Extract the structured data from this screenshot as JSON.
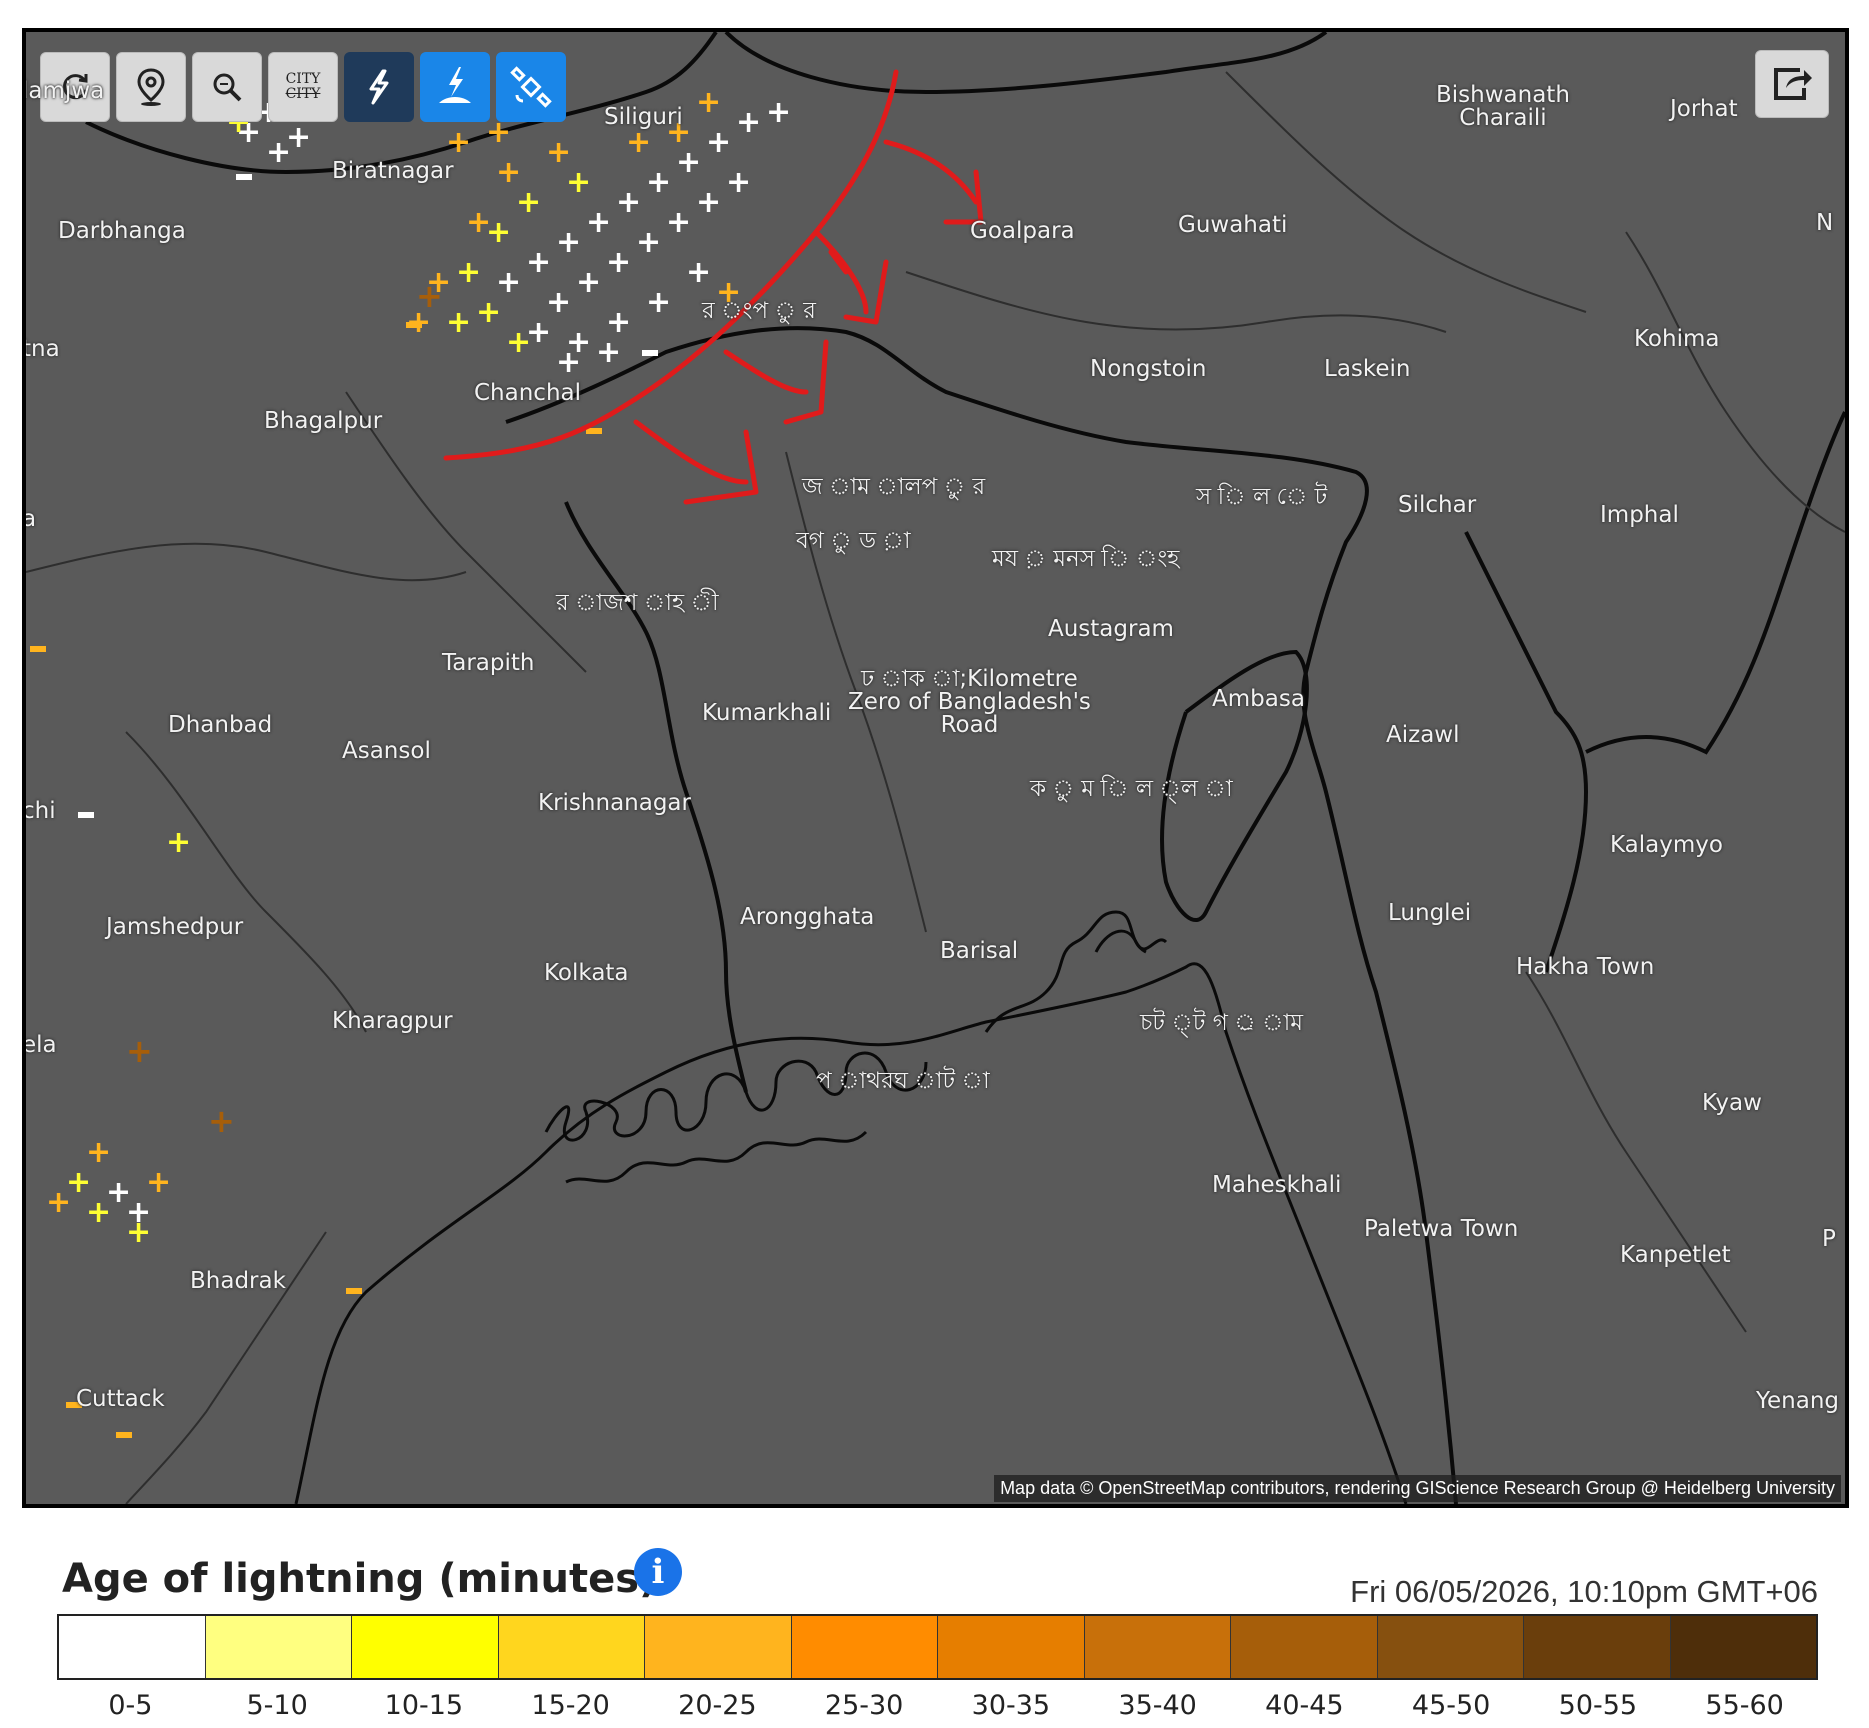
{
  "toolbar": {
    "buttons": [
      {
        "name": "refresh-icon"
      },
      {
        "name": "location-pin-icon"
      },
      {
        "name": "zoom-icon"
      },
      {
        "name": "city-toggle",
        "text_top": "CITY",
        "text_bottom": "CITY"
      },
      {
        "name": "lightning-icon"
      },
      {
        "name": "lightning-ground-icon"
      },
      {
        "name": "satellite-icon"
      }
    ],
    "share": "share-icon"
  },
  "map": {
    "attribution": "Map data © OpenStreetMap contributors, rendering GIScience Research Group @ Heidelberg University",
    "cities": [
      {
        "id": "siliguri",
        "label": "Siliguri"
      },
      {
        "id": "biratnagar",
        "label": "Biratnagar"
      },
      {
        "id": "darbhanga",
        "label": "Darbhanga"
      },
      {
        "id": "patna",
        "label": "tna"
      },
      {
        "id": "bhagalpur",
        "label": "Bhagalpur"
      },
      {
        "id": "chanchal",
        "label": "Chanchal"
      },
      {
        "id": "goalpara",
        "label": "Goalpara"
      },
      {
        "id": "guwahati",
        "label": "Guwahati"
      },
      {
        "id": "bishwanath",
        "label": "Bishwanath\nCharaili"
      },
      {
        "id": "jorhat",
        "label": "Jorhat"
      },
      {
        "id": "nongstoin",
        "label": "Nongstoin"
      },
      {
        "id": "laskein",
        "label": "Laskein"
      },
      {
        "id": "kohima",
        "label": "Kohima"
      },
      {
        "id": "rangpur",
        "label": "র ংপ ু র"
      },
      {
        "id": "jamalpur",
        "label": "জ াম ালপ ু র"
      },
      {
        "id": "bogura",
        "label": "বগ ু ড ়া"
      },
      {
        "id": "mymensingh",
        "label": "ময ় মনস ি ংহ"
      },
      {
        "id": "sylhet",
        "label": "স ি ল ে ট"
      },
      {
        "id": "silchar",
        "label": "Silchar"
      },
      {
        "id": "imphal",
        "label": "Imphal"
      },
      {
        "id": "rajshahi",
        "label": "র াজশ াহ ী"
      },
      {
        "id": "austagram",
        "label": "Austagram"
      },
      {
        "id": "tarapith",
        "label": "Tarapith"
      },
      {
        "id": "dhaka",
        "label": "ঢ াক া;Kilometre\nZero of Bangladesh's\nRoad"
      },
      {
        "id": "kumarkhali",
        "label": "Kumarkhali"
      },
      {
        "id": "ambasa",
        "label": "Ambasa"
      },
      {
        "id": "aizawl",
        "label": "Aizawl"
      },
      {
        "id": "dhanbad",
        "label": "Dhanbad"
      },
      {
        "id": "asansol",
        "label": "Asansol"
      },
      {
        "id": "ranchi",
        "label": "chi"
      },
      {
        "id": "krishnanagar",
        "label": "Krishnanagar"
      },
      {
        "id": "comilla",
        "label": "ক ু ম ি ল ্ল া"
      },
      {
        "id": "kalaymyo",
        "label": "Kalaymyo"
      },
      {
        "id": "jamshedpur",
        "label": "Jamshedpur"
      },
      {
        "id": "arongghata",
        "label": "Arongghata"
      },
      {
        "id": "lunglei",
        "label": "Lunglei"
      },
      {
        "id": "barisal",
        "label": "Barisal"
      },
      {
        "id": "kolkata",
        "label": "Kolkata"
      },
      {
        "id": "hakha",
        "label": "Hakha Town"
      },
      {
        "id": "kharagpur",
        "label": "Kharagpur"
      },
      {
        "id": "chattogram",
        "label": "চট ্ট গ ্র াম"
      },
      {
        "id": "patharghata",
        "label": "প াথরঘ াট া"
      },
      {
        "id": "rourkela",
        "label": "ela"
      },
      {
        "id": "kyaw",
        "label": "Kyaw"
      },
      {
        "id": "maheskhali",
        "label": "Maheskhali"
      },
      {
        "id": "paletwa",
        "label": "Paletwa Town"
      },
      {
        "id": "kanpetlet",
        "label": "Kanpetlet"
      },
      {
        "id": "bhadrak",
        "label": "Bhadrak"
      },
      {
        "id": "cuttack",
        "label": "Cuttack"
      },
      {
        "id": "yenang",
        "label": "Yenang"
      },
      {
        "id": "edge_n",
        "label": "N"
      },
      {
        "id": "edge_p",
        "label": "P"
      },
      {
        "id": "edge_a",
        "label": "a"
      },
      {
        "id": "edge_lamjw",
        "label": "lamjwa"
      }
    ]
  },
  "legend": {
    "title": "Age of lightning (minutes)",
    "timestamp": "Fri 06/05/2026, 10:10pm GMT+06",
    "ranges": [
      {
        "label": "0-5",
        "color": "#ffffff"
      },
      {
        "label": "5-10",
        "color": "#ffff80"
      },
      {
        "label": "10-15",
        "color": "#ffff00"
      },
      {
        "label": "15-20",
        "color": "#ffd61e"
      },
      {
        "label": "20-25",
        "color": "#ffb41e"
      },
      {
        "label": "25-30",
        "color": "#ff8c00"
      },
      {
        "label": "30-35",
        "color": "#e67e00"
      },
      {
        "label": "35-40",
        "color": "#c8700a"
      },
      {
        "label": "40-45",
        "color": "#a65e0a"
      },
      {
        "label": "45-50",
        "color": "#86500f"
      },
      {
        "label": "50-55",
        "color": "#6a3e0c"
      },
      {
        "label": "55-60",
        "color": "#4e2e0a"
      }
    ]
  }
}
